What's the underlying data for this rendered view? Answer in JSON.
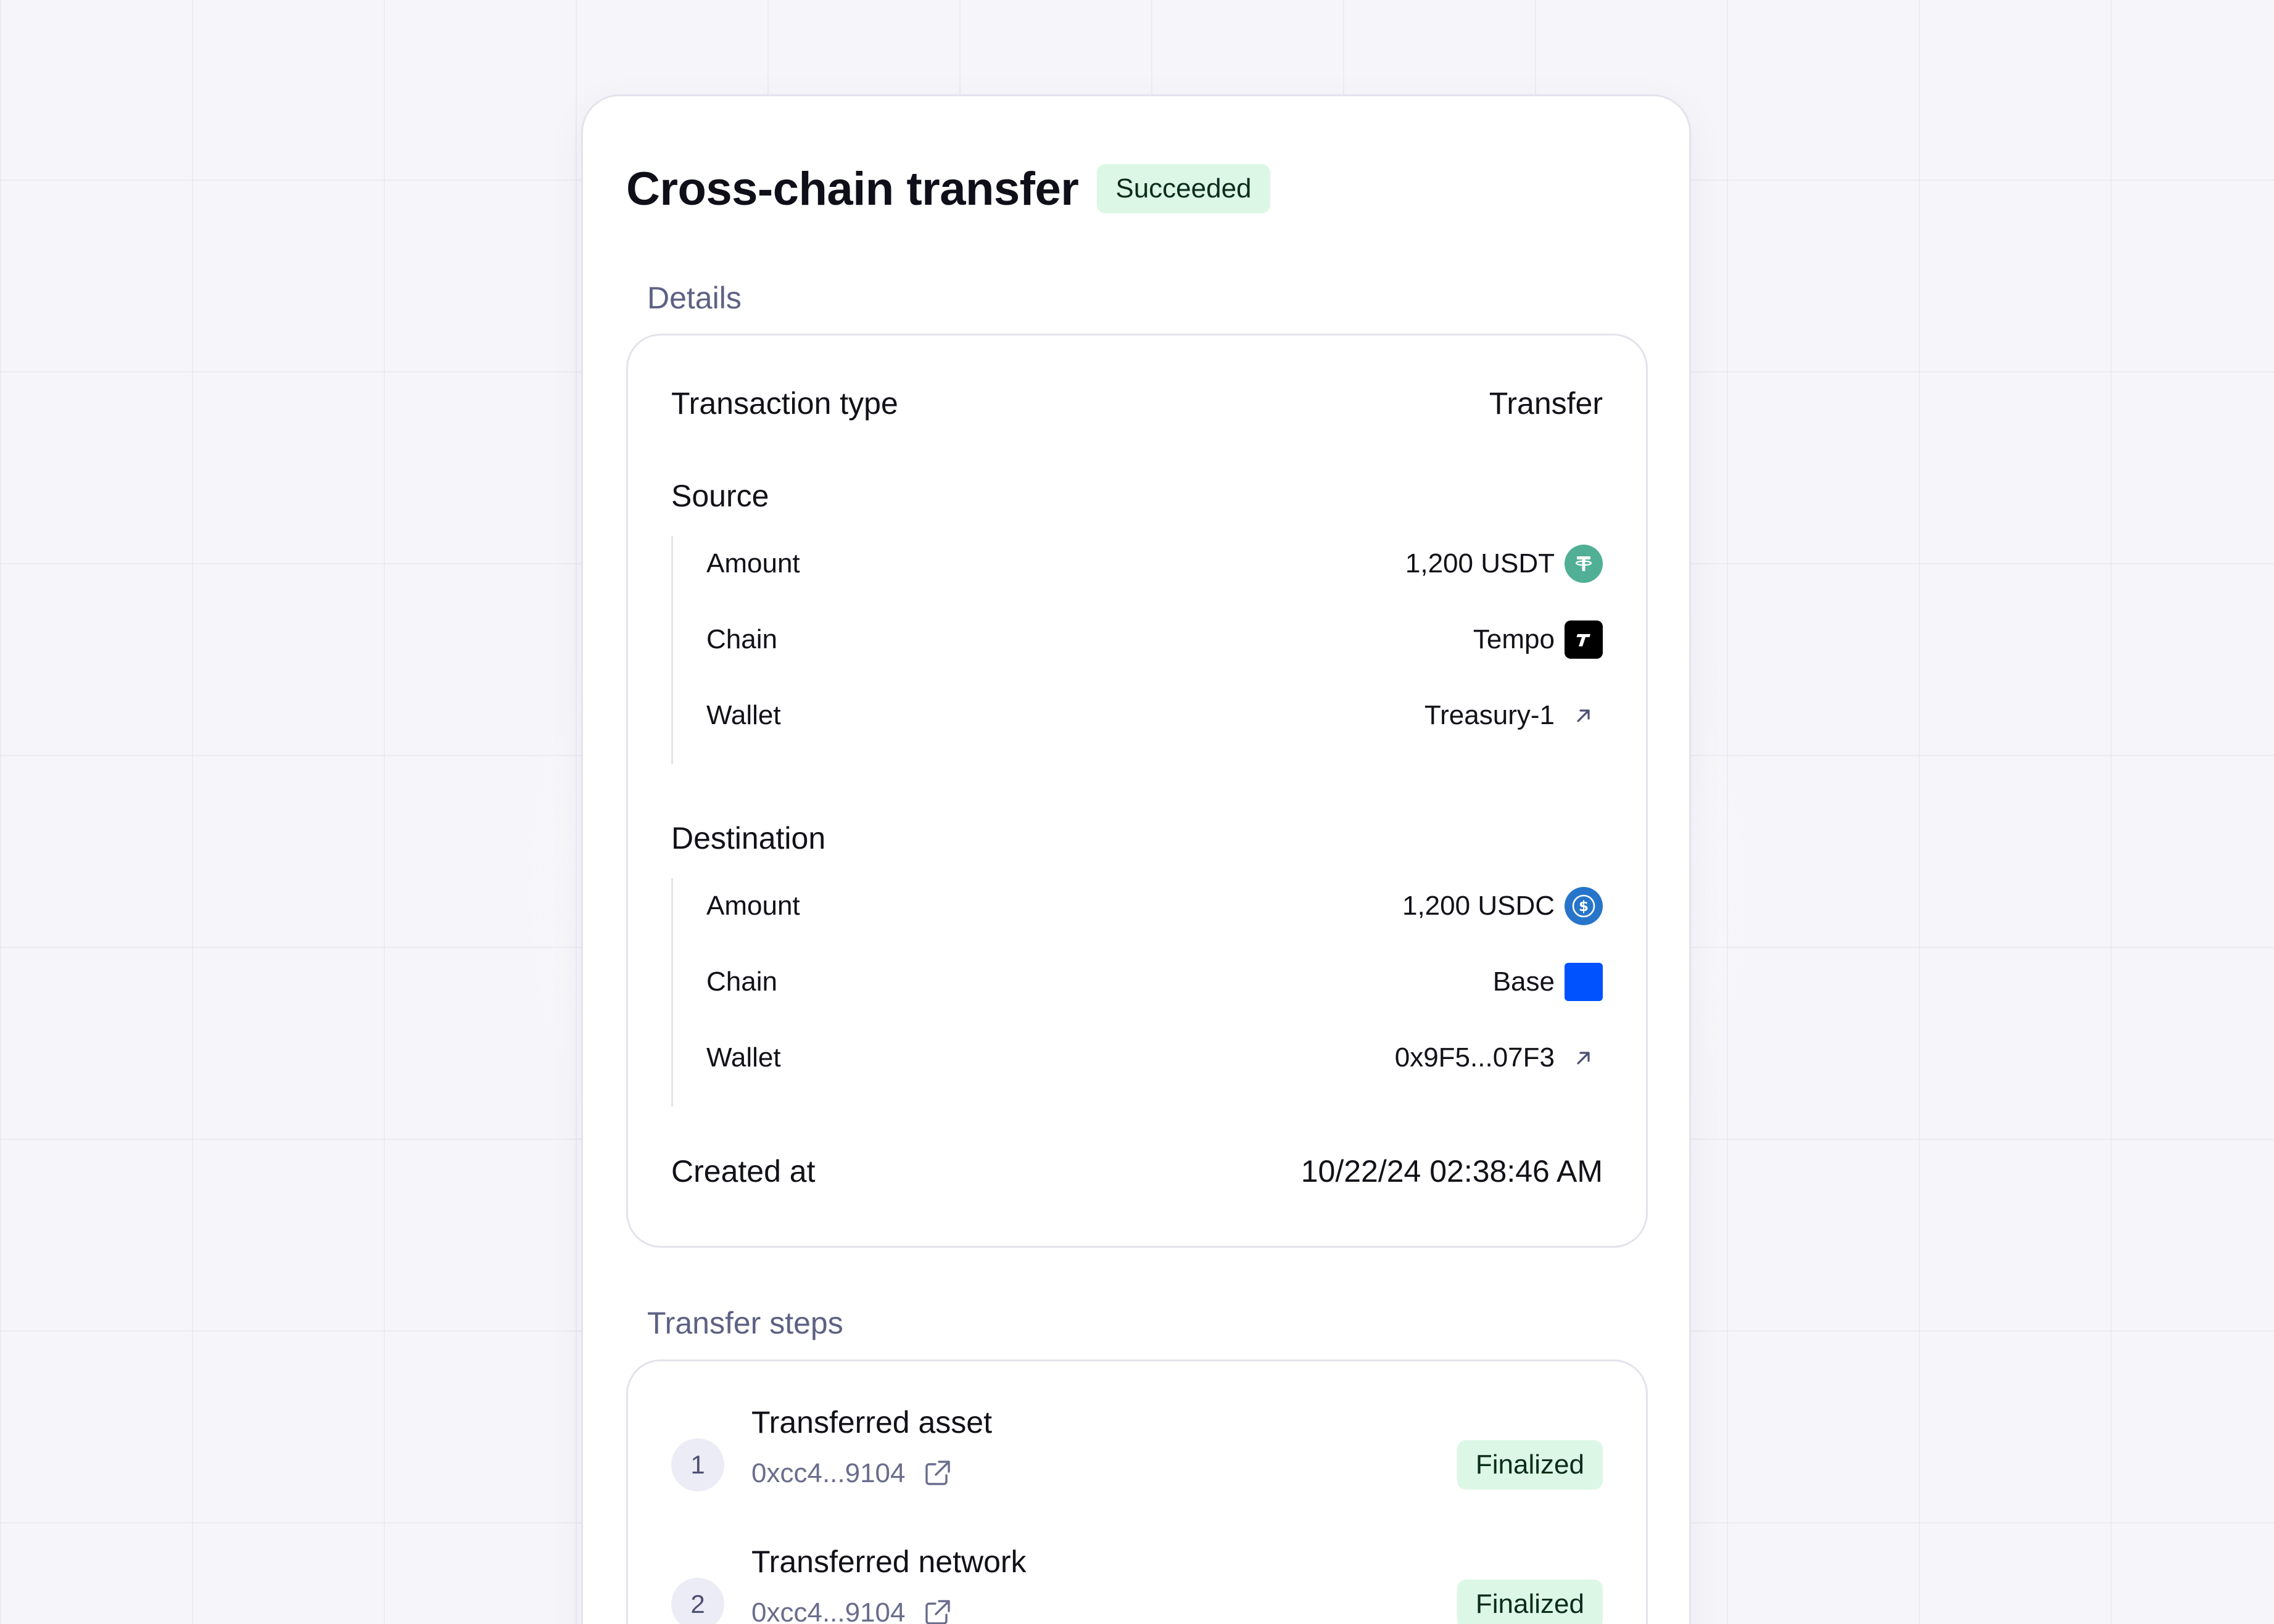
{
  "header": {
    "title": "Cross-chain transfer",
    "status": "Succeeded"
  },
  "details": {
    "section_label": "Details",
    "transaction_type": {
      "label": "Transaction type",
      "value": "Transfer"
    },
    "source": {
      "heading": "Source",
      "amount": {
        "label": "Amount",
        "value": "1,200 USDT",
        "icon": "tether-icon"
      },
      "chain": {
        "label": "Chain",
        "value": "Tempo",
        "icon": "tempo-chain-icon"
      },
      "wallet": {
        "label": "Wallet",
        "value": "Treasury-1",
        "icon": "arrow-up-right-icon"
      }
    },
    "destination": {
      "heading": "Destination",
      "amount": {
        "label": "Amount",
        "value": "1,200 USDC",
        "icon": "usdc-icon"
      },
      "chain": {
        "label": "Chain",
        "value": "Base",
        "icon": "base-chain-icon"
      },
      "wallet": {
        "label": "Wallet",
        "value": "0x9F5...07F3",
        "icon": "arrow-up-right-icon"
      }
    },
    "created_at": {
      "label": "Created at",
      "value": "10/22/24 02:38:46 AM"
    }
  },
  "transfer_steps": {
    "section_label": "Transfer steps",
    "steps": [
      {
        "number": "1",
        "title": "Transferred asset",
        "hash": "0xcc4...9104",
        "status": "Finalized"
      },
      {
        "number": "2",
        "title": "Transferred network",
        "hash": "0xcc4...9104",
        "status": "Finalized"
      }
    ]
  },
  "colors": {
    "success_badge_bg": "#dcf7e6",
    "tether_green": "#50af95",
    "usdc_blue": "#2775ca",
    "base_blue": "#0052ff",
    "tempo_black": "#000000",
    "muted_text": "#5d6183"
  }
}
